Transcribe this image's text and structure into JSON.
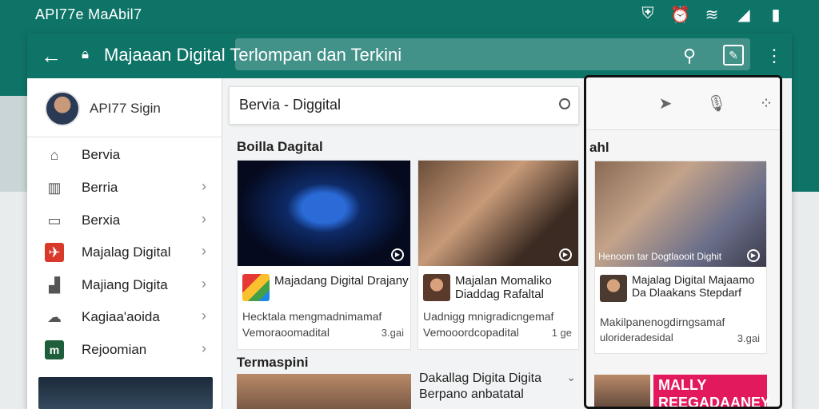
{
  "status_bar": {
    "title": "API77e MaAbil7",
    "icons": [
      "shield-icon",
      "alarm-icon",
      "wifi-icon",
      "signal-icon",
      "battery-icon"
    ]
  },
  "app_bar": {
    "title": "Majaaan Digital Terlompan dan Terkini"
  },
  "sidebar": {
    "profile_name": "API77 Sigin",
    "items": [
      {
        "label": "Bervia",
        "icon": "home-icon",
        "chevron": false
      },
      {
        "label": "Berria",
        "icon": "briefcase-icon",
        "chevron": true
      },
      {
        "label": "Berxia",
        "icon": "tag-icon",
        "chevron": true
      },
      {
        "label": "Majalag Digital",
        "icon": "red-tag-icon",
        "chevron": true
      },
      {
        "label": "Majiang Digita",
        "icon": "bar-chart-icon",
        "chevron": true
      },
      {
        "label": "Kagiaa'aoida",
        "icon": "cloud-icon",
        "chevron": true
      },
      {
        "label": "Rejoomian",
        "icon": "m-badge-icon",
        "chevron": true
      }
    ]
  },
  "main": {
    "search_value": "Bervia - Diggital",
    "section1_title": "Boilla Dagital",
    "cards": [
      {
        "title": "Majadang Digital Drajany",
        "desc": "Hecktala mengmadnimamaf",
        "desc2": "Vemoraoomadital",
        "num": "3.gai"
      },
      {
        "title": "Majalan Momaliko Diaddag Rafaltal",
        "desc": "Uadnigg mnigradicngemaf",
        "desc2": "Vemooordcopadital",
        "num": "1 ge"
      }
    ],
    "section2_title": "Termaspini",
    "bottom_card_title": "Dakallag Digita Digita Berpano anbatatal"
  },
  "panel": {
    "section_title": "ahl",
    "image_caption": "Henoom tar Dogtlaooit Dighit",
    "card_title": "Majalag Digital Majaamo Da Dlaakans Stepdarf",
    "card_desc": "Makilpanenogdirngsamaf",
    "card_desc2": "ulorideradesidal",
    "card_num": "3.gai",
    "bottom_banner": "MALLY REEGADAANEY"
  },
  "colors": {
    "primary": "#0f7468",
    "accent": "#d8392b"
  }
}
